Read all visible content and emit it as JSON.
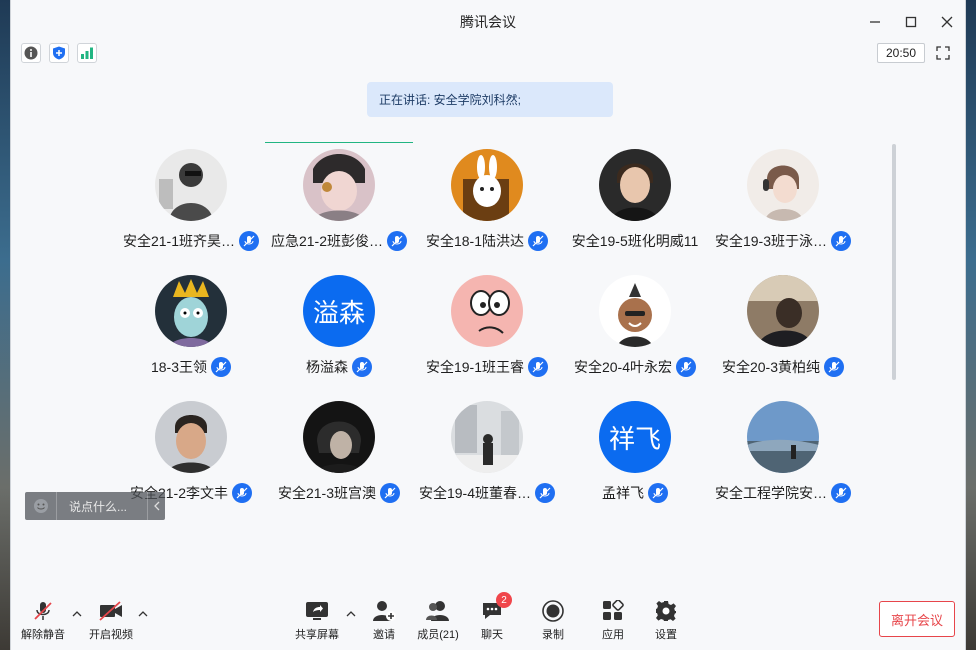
{
  "window": {
    "title": "腾讯会议"
  },
  "infobar": {
    "timer": "20:50"
  },
  "banner": {
    "speaking": "正在讲话: 安全学院刘科然;"
  },
  "participants": [
    {
      "name": "安全21-1班齐昊…"
    },
    {
      "name": "应急21-2班彭俊…"
    },
    {
      "name": "安全18-1陆洪达"
    },
    {
      "name": "安全19-5班化明威11"
    },
    {
      "name": "安全19-3班于泳…"
    },
    {
      "name": "18-3王领"
    },
    {
      "name": "杨溢森",
      "avatar_text": "溢森"
    },
    {
      "name": "安全19-1班王睿"
    },
    {
      "name": "安全20-4叶永宏"
    },
    {
      "name": "安全20-3黄柏纯"
    },
    {
      "name": "安全21-2李文丰"
    },
    {
      "name": "安全21-3班宫澳"
    },
    {
      "name": "安全19-4班董春…"
    },
    {
      "name": "孟祥飞",
      "avatar_text": "祥飞"
    },
    {
      "name": "安全工程学院安…"
    }
  ],
  "chat": {
    "placeholder": "说点什么..."
  },
  "toolbar": {
    "unmute": "解除静音",
    "video": "开启视频",
    "share": "共享屏幕",
    "invite": "邀请",
    "members": "成员(21)",
    "chat": "聊天",
    "chat_badge": "2",
    "record": "录制",
    "apps": "应用",
    "settings": "设置",
    "leave": "离开会议"
  },
  "colors": {
    "accent": "#1f6ff2",
    "leave": "#e7454a",
    "badge": "#f0464b",
    "active": "#21b582"
  }
}
